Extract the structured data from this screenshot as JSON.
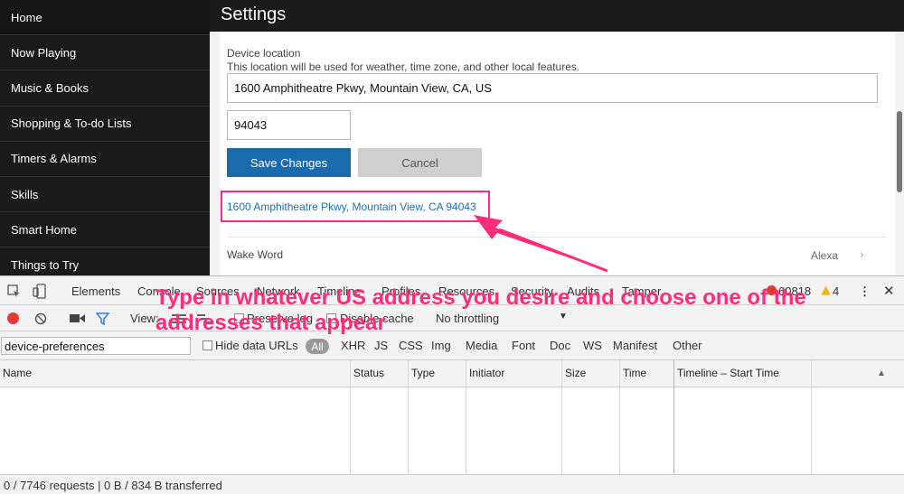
{
  "sidebar": {
    "items": [
      {
        "label": "Home"
      },
      {
        "label": "Now Playing"
      },
      {
        "label": "Music & Books"
      },
      {
        "label": "Shopping & To-do Lists"
      },
      {
        "label": "Timers & Alarms"
      },
      {
        "label": "Skills"
      },
      {
        "label": "Smart Home"
      },
      {
        "label": "Things to Try"
      }
    ]
  },
  "header": {
    "title": "Settings"
  },
  "location": {
    "label": "Device location",
    "help": "This location will be used for weather, time zone, and other local features.",
    "address_value": "1600 Amphitheatre Pkwy, Mountain View, CA, US",
    "zip_value": "94043",
    "save_label": "Save Changes",
    "cancel_label": "Cancel",
    "suggestion": "1600 Amphitheatre Pkwy, Mountain View, CA 94043"
  },
  "wake_word": {
    "label": "Wake Word",
    "value": "Alexa"
  },
  "devtools": {
    "tabs": [
      "Elements",
      "Console",
      "Sources",
      "Network",
      "Timeline",
      "Profiles",
      "Resources",
      "Security",
      "Audits",
      "Tamper"
    ],
    "error_count": "60818",
    "warning_count": "4",
    "toolbar": {
      "view_label": "View:",
      "preserve_log": "Preserve log",
      "disable_cache": "Disable cache",
      "throttling": "No throttling"
    },
    "filter": {
      "value": "device-preferences",
      "hide_data_urls": "Hide data URLs",
      "types": [
        "All",
        "XHR",
        "JS",
        "CSS",
        "Img",
        "Media",
        "Font",
        "Doc",
        "WS",
        "Manifest",
        "Other"
      ]
    },
    "columns": [
      "Name",
      "Status",
      "Type",
      "Initiator",
      "Size",
      "Time",
      "Timeline – Start Time"
    ],
    "status_bar": "0 / 7746 requests  |  0 B / 834 B transferred"
  },
  "annotation": {
    "text": "Type in whatever US address you desire and choose one of the addresses that appear"
  },
  "colors": {
    "accent": "#ff2d7a",
    "primary_button": "#1a6aae",
    "sidebar_bg": "#1a1a1a"
  }
}
